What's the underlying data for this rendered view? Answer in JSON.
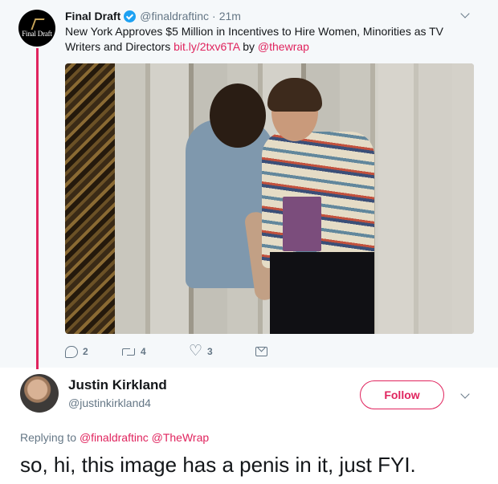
{
  "parent_tweet": {
    "author_name": "Final Draft",
    "verified_icon": "verified-badge-icon",
    "handle": "@finaldraftinc",
    "separator": "·",
    "time": "21m",
    "avatar_text": "Final Draft",
    "text_before_link": "New York Approves $5 Million in Incentives to Hire Women, Minorities as TV Writers and Directors ",
    "link": "bit.ly/2txv6TA",
    "text_by": " by ",
    "mention": "@thewrap",
    "actions": {
      "reply_count": "2",
      "retweet_count": "4",
      "like_count": "3"
    }
  },
  "reply_tweet": {
    "author_name": "Justin Kirkland",
    "handle": "@justinkirkland4",
    "follow_label": "Follow",
    "replying_prefix": "Replying to ",
    "replying_to": "@finaldraftinc @TheWrap",
    "text": "so, hi, this image has a penis in it, just FYI."
  },
  "colors": {
    "accent": "#e0245e",
    "verified": "#1da1f2",
    "secondary_text": "#657786",
    "parent_background": "#f5f8fa"
  }
}
